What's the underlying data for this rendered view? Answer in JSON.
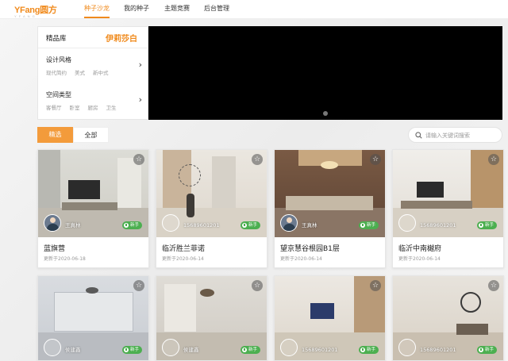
{
  "header": {
    "logo_text": "YFang",
    "logo_cn": "圆方",
    "logo_sub": "Y F A N G",
    "nav": [
      {
        "label": "种子沙龙",
        "active": true
      },
      {
        "label": "我的种子",
        "active": false
      },
      {
        "label": "主题竞赛",
        "active": false
      },
      {
        "label": "后台管理",
        "active": false
      }
    ]
  },
  "library": {
    "title": "精品库",
    "brand": "伊莉莎白",
    "sections": [
      {
        "title": "设计风格",
        "items": [
          "现代简约",
          "美式",
          "新中式"
        ]
      },
      {
        "title": "空间类型",
        "items": [
          "客餐厅",
          "卧室",
          "厨房",
          "卫生"
        ]
      }
    ]
  },
  "tabs": {
    "selected": "精选",
    "all": "全部"
  },
  "search": {
    "placeholder": "请输入关键词搜索"
  },
  "colors": {
    "accent": "#f08a1c",
    "badge": "#4caf50",
    "banner": "#000000"
  },
  "cards": [
    {
      "title": "蓝旗营",
      "date": "更新于2020-06-18",
      "author": "王真林",
      "badge": "新手",
      "avatar": "photo"
    },
    {
      "title": "临沂胜兰菲诺",
      "date": "更新于2020-06-14",
      "author": "15689601201",
      "badge": "新手",
      "avatar": "empty"
    },
    {
      "title": "望京慧谷根园B1层",
      "date": "更新于2020-06-14",
      "author": "王真林",
      "badge": "新手",
      "avatar": "photo"
    },
    {
      "title": "临沂中南樾府",
      "date": "更新于2020-06-14",
      "author": "15689601201",
      "badge": "新手",
      "avatar": "empty"
    },
    {
      "title": "",
      "date": "",
      "author": "侯建鑫",
      "badge": "新手",
      "avatar": "empty"
    },
    {
      "title": "",
      "date": "",
      "author": "侯建鑫",
      "badge": "新手",
      "avatar": "empty"
    },
    {
      "title": "",
      "date": "",
      "author": "15689601201",
      "badge": "新手",
      "avatar": "empty"
    },
    {
      "title": "",
      "date": "",
      "author": "15689601201",
      "badge": "新手",
      "avatar": "empty"
    }
  ]
}
